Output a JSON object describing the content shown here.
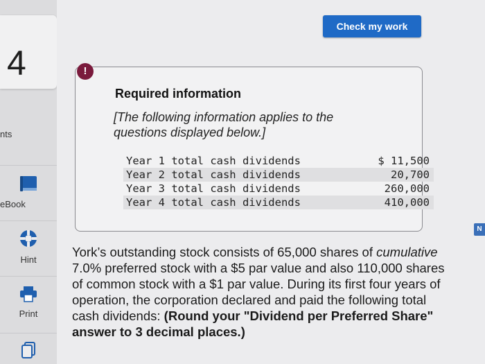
{
  "sidebar": {
    "question_number": "4",
    "points_label": "nts",
    "tools": [
      {
        "label": "eBook",
        "icon": "book-icon"
      },
      {
        "label": "Hint",
        "icon": "lifebuoy-icon"
      },
      {
        "label": "Print",
        "icon": "printer-icon"
      },
      {
        "label": "",
        "icon": "copy-icon"
      }
    ]
  },
  "header": {
    "check_button_label": "Check my work"
  },
  "info_box": {
    "alert_symbol": "!",
    "title": "Required information",
    "note": "[The following information applies to the questions displayed below.]",
    "rows": [
      {
        "label": "Year 1 total cash dividends",
        "value": "$ 11,500"
      },
      {
        "label": "Year 2 total cash dividends",
        "value": "20,700"
      },
      {
        "label": "Year 3 total cash dividends",
        "value": "260,000"
      },
      {
        "label": "Year 4 total cash dividends",
        "value": "410,000"
      }
    ]
  },
  "right_tab_label": "N",
  "question": {
    "part1": "York’s outstanding stock consists of 65,000 shares of ",
    "italic": "cumulative",
    "part2": " 7.0% preferred stock with a $5 par value and also 110,000 shares of common stock with a $1 par value. During its first four years of operation, the corporation declared and paid the following total cash dividends: ",
    "bold": "(Round your \"Dividend per Preferred Share\" answer to 3 decimal places.)"
  },
  "colors": {
    "accent": "#1f6ac6",
    "alert": "#7a1a3c"
  }
}
